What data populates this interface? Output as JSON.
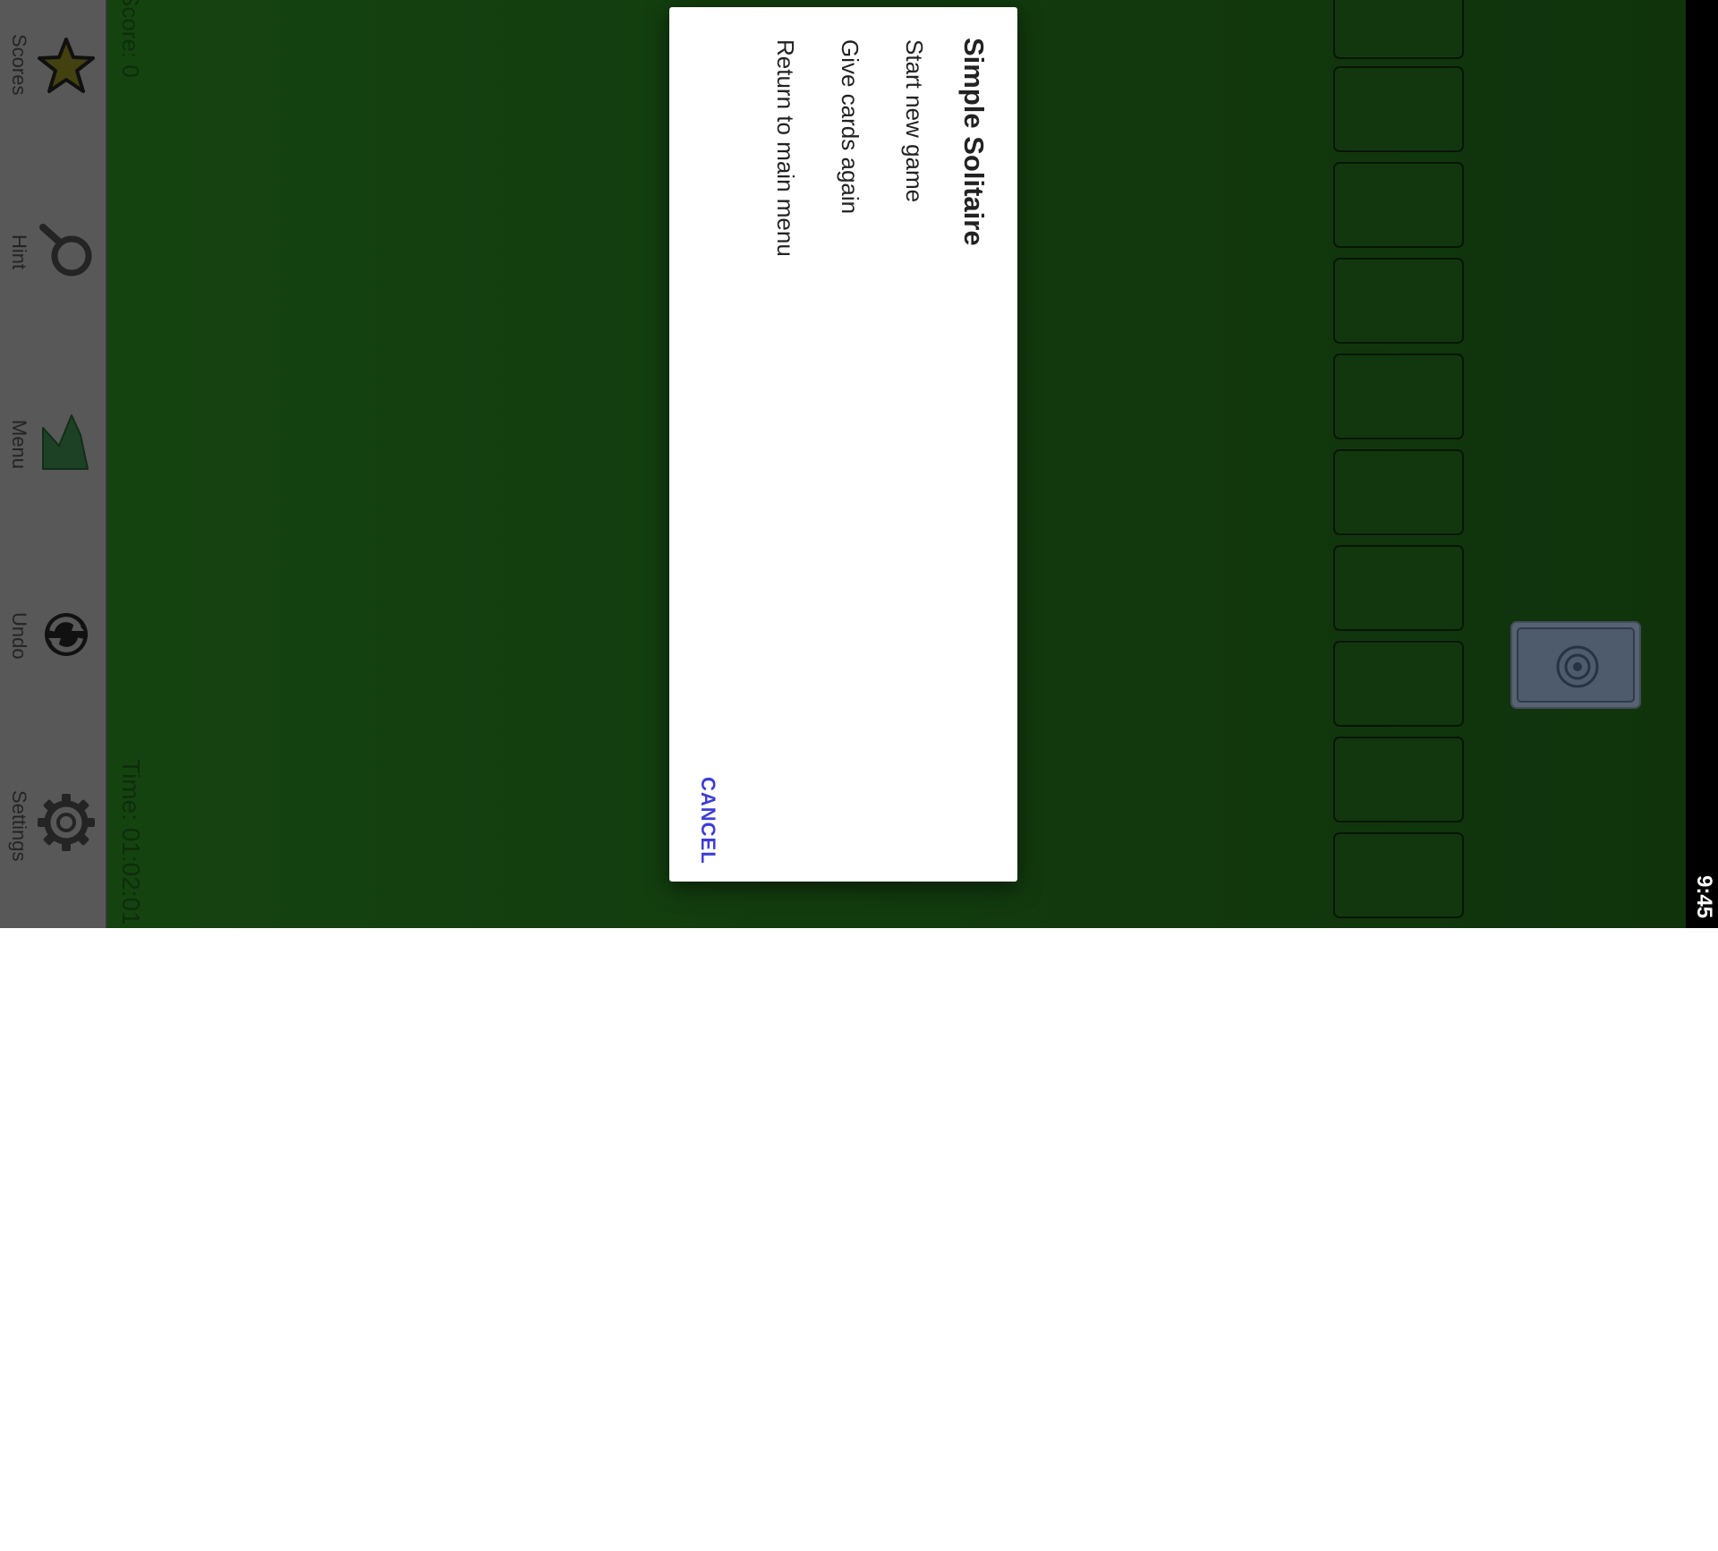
{
  "toolbar": {
    "items": [
      {
        "label": "Scores",
        "icon": "star-icon"
      },
      {
        "label": "Hint",
        "icon": "magnifier-icon"
      },
      {
        "label": "Menu",
        "icon": "menu-arrow-icon"
      },
      {
        "label": "Undo",
        "icon": "undo-icon"
      },
      {
        "label": "Settings",
        "icon": "gear-icon"
      }
    ]
  },
  "game": {
    "score_text": "Score: 0",
    "time_text": "Time: 01:02:01"
  },
  "status_bar": {
    "clock": "9:45"
  },
  "dialog": {
    "title": "Simple Solitaire",
    "options": [
      "Start new game",
      "Give cards again",
      "Return to main menu"
    ],
    "cancel_label": "CANCEL"
  },
  "colors": {
    "felt": "#1e5f17",
    "toolbar": "#8e8e8e",
    "accent": "#3d3dd6"
  }
}
